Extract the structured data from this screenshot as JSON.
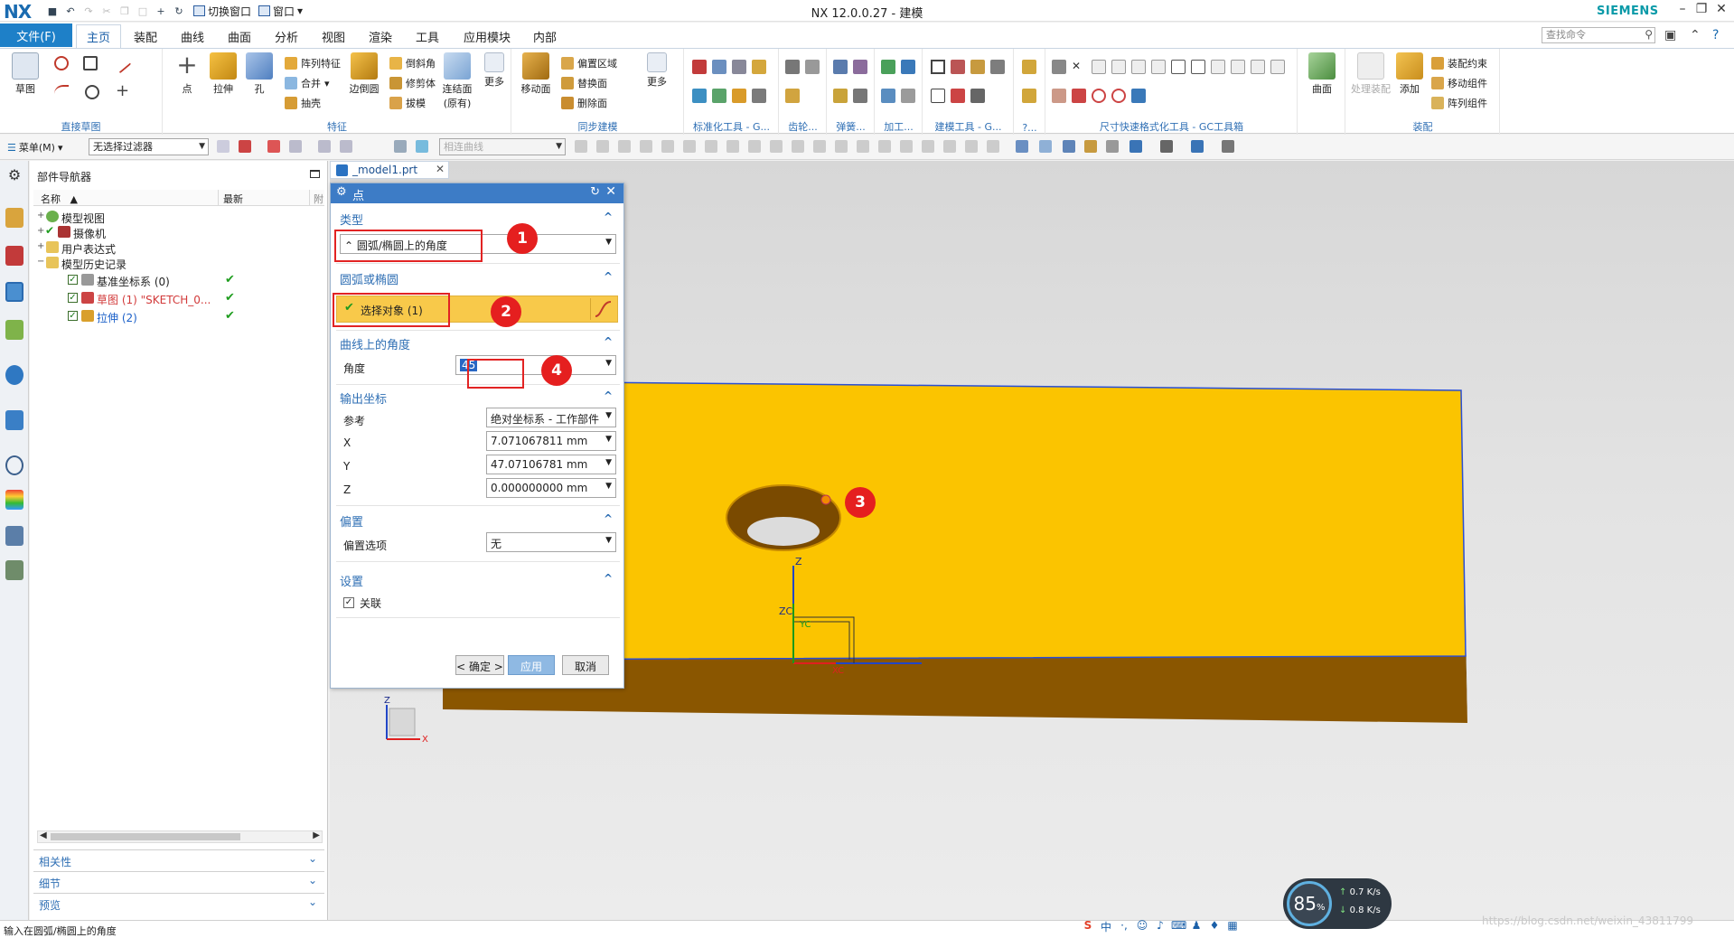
{
  "app": {
    "logo": "NX",
    "title": "NX 12.0.0.27 - 建模",
    "brand": "SIEMENS",
    "qat_switch_window": "切换窗口",
    "qat_window": "窗口"
  },
  "tabs": {
    "file": "文件(F)",
    "items": [
      "主页",
      "装配",
      "曲线",
      "曲面",
      "分析",
      "视图",
      "渲染",
      "工具",
      "应用模块",
      "内部"
    ],
    "active_index": 0,
    "search_placeholder": "查找命令"
  },
  "ribbon": {
    "sketch": "草图",
    "groups": {
      "direct_sketch": "直接草图",
      "feature": "特征",
      "sync": "同步建模",
      "std_tools": "标准化工具 - G...",
      "gear": "齿轮...",
      "spring": "弹簧...",
      "machining": "加工...",
      "modeling_tools": "建模工具 - G...",
      "more_g": "?...",
      "dim_tools": "尺寸快速格式化工具 - GC工具箱",
      "assembly": "装配"
    },
    "buttons": {
      "point": "点",
      "extrude": "拉伸",
      "hole": "孔",
      "pattern_feature": "阵列特征",
      "unite": "合并",
      "shell": "抽壳",
      "edge_blend": "边倒圆",
      "chamfer": "倒斜角",
      "trim_body": "修剪体",
      "draft": "拔模",
      "join_face": "连结面(原有)",
      "more": "更多",
      "move_face": "移动面",
      "offset_region": "偏置区域",
      "replace_face": "替换面",
      "delete_face": "删除面",
      "more2": "更多",
      "surface": "曲面",
      "process_assembly": "处理装配",
      "add": "添加",
      "assembly_constraint": "装配约束",
      "move_component": "移动组件",
      "pattern_component": "阵列组件"
    }
  },
  "toolbar2": {
    "menu": "菜单(M)",
    "filter": "无选择过滤器",
    "curve_rule": "相连曲线"
  },
  "navigator": {
    "title": "部件导航器",
    "col_name": "名称",
    "col_latest": "最新",
    "col_more": "附",
    "rows": [
      {
        "label": "模型视图",
        "expand": "+",
        "level": 0,
        "check": false,
        "latest": ""
      },
      {
        "label": "摄像机",
        "expand": "+",
        "level": 0,
        "check": true,
        "latest": ""
      },
      {
        "label": "用户表达式",
        "expand": "+",
        "level": 0,
        "check": false,
        "latest": ""
      },
      {
        "label": "模型历史记录",
        "expand": "−",
        "level": 0,
        "check": false,
        "latest": ""
      },
      {
        "label": "基准坐标系 (0)",
        "expand": "",
        "level": 1,
        "check": true,
        "latest": "✔"
      },
      {
        "label": "草图 (1) \"SKETCH_0...",
        "expand": "",
        "level": 1,
        "check": true,
        "latest": "✔",
        "color": "#d23a3a"
      },
      {
        "label": "拉伸 (2)",
        "expand": "",
        "level": 1,
        "check": true,
        "latest": "✔",
        "color": "#1a5fc8"
      }
    ],
    "panels": [
      "相关性",
      "细节",
      "预览"
    ]
  },
  "doc_tab": "_model1.prt",
  "dialog": {
    "title": "点",
    "type_section": "类型",
    "type_value": "圆弧/椭圆上的角度",
    "arc_section": "圆弧或椭圆",
    "select_object": "选择对象 (1)",
    "angle_section": "曲线上的角度",
    "angle_label": "角度",
    "angle_value": "45",
    "output_section": "输出坐标",
    "ref_label": "参考",
    "ref_value": "绝对坐标系 - 工作部件",
    "x_label": "X",
    "x_value": "7.071067811 mm",
    "y_label": "Y",
    "y_value": "47.07106781 mm",
    "z_label": "Z",
    "z_value": "0.000000000 mm",
    "offset_section": "偏置",
    "offset_label": "偏置选项",
    "offset_value": "无",
    "settings_section": "设置",
    "assoc_label": "关联",
    "assoc_checked": true,
    "ok": "< 确定 >",
    "apply": "应用",
    "cancel": "取消"
  },
  "callouts": [
    "1",
    "2",
    "3",
    "4"
  ],
  "viewport": {
    "block_top_color": "#fbc400",
    "block_side_color": "#8b5700",
    "triad_z": "Z",
    "triad_x": "X",
    "wcs_zc": "ZC",
    "wcs_yc": "YC",
    "wcs_xc": "XC"
  },
  "status": {
    "prompt": "输入在圆弧/椭圆上的角度",
    "speed_pct": "85",
    "speed_unit": "%",
    "up": "0.7",
    "down": "0.8",
    "speed_units": "K/s",
    "ime": "中",
    "watermark": "https://blog.csdn.net/weixin_43811799"
  }
}
